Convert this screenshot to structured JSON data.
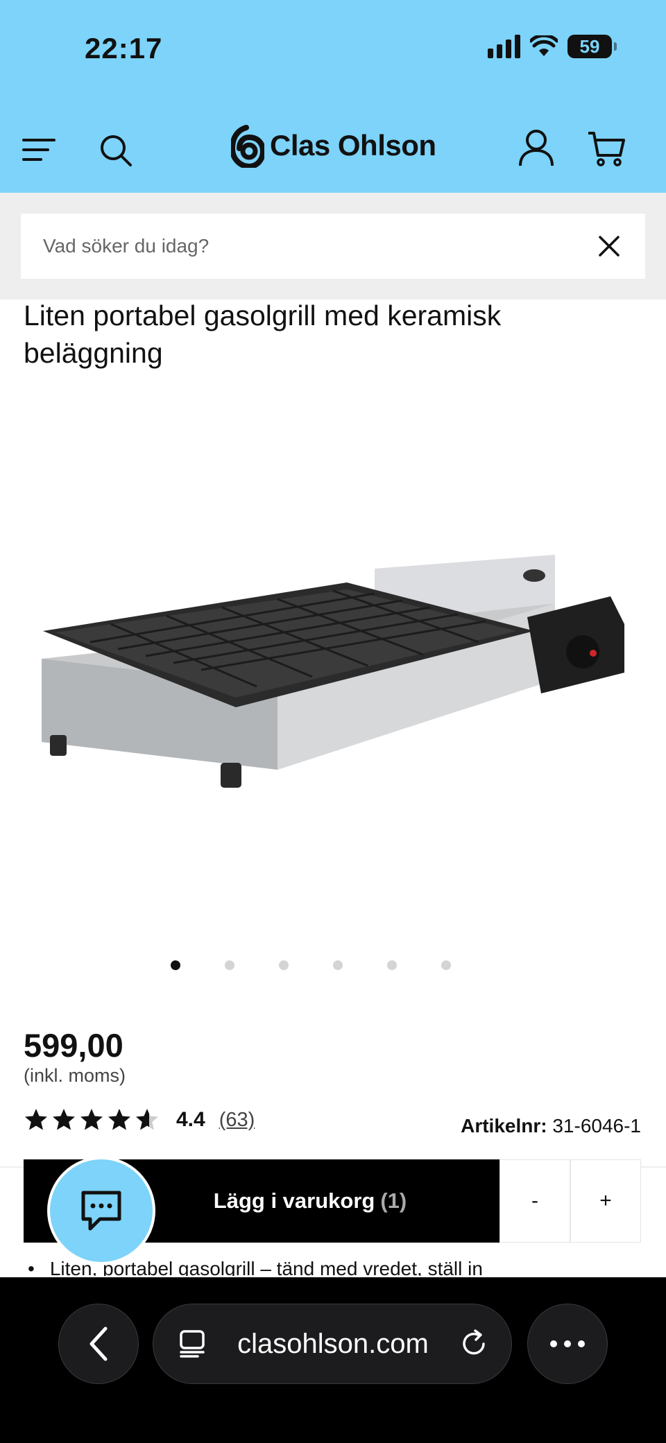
{
  "status_bar": {
    "time": "22:17",
    "battery": "59"
  },
  "header": {
    "brand": "Clas Ohlson"
  },
  "search": {
    "placeholder": "Vad söker du idag?"
  },
  "product": {
    "title": "Liten portabel gasolgrill med keramisk beläggning",
    "image_count": 6,
    "active_image_index": 0,
    "price": "599,00",
    "price_note": "(inkl. moms)",
    "rating": {
      "value": "4.4",
      "stars_fraction": 0.88,
      "count": "(63)"
    },
    "article_label": "Artikelnr:",
    "article_number": "31-6046-1",
    "bullet_preview": "Liten, portabel gasolgrill – tänd med vredet, ställ in"
  },
  "cart": {
    "add_label": "Lägg i varukorg",
    "quantity": "(1)",
    "minus": "-",
    "plus": "+"
  },
  "browser": {
    "url": "clasohlson.com"
  },
  "colors": {
    "header_bg": "#7dd3f9",
    "button_bg": "#000000",
    "search_area_bg": "#eeeeee"
  }
}
